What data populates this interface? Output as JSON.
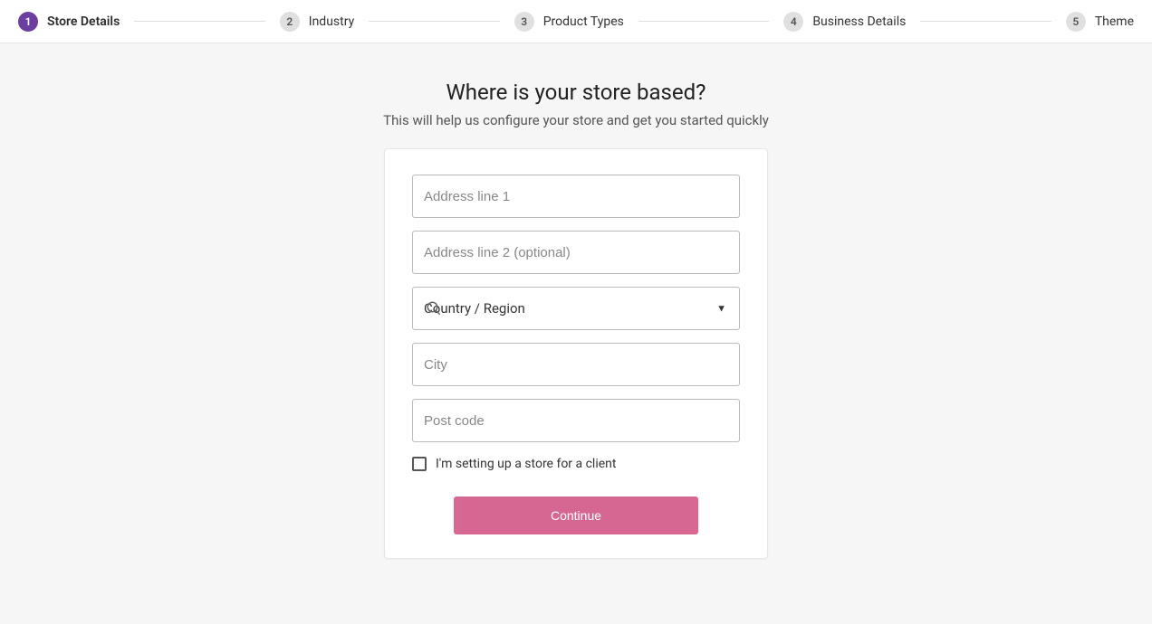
{
  "stepper": {
    "steps": [
      {
        "num": "1",
        "label": "Store Details",
        "active": true
      },
      {
        "num": "2",
        "label": "Industry",
        "active": false
      },
      {
        "num": "3",
        "label": "Product Types",
        "active": false
      },
      {
        "num": "4",
        "label": "Business Details",
        "active": false
      },
      {
        "num": "5",
        "label": "Theme",
        "active": false
      }
    ]
  },
  "heading": {
    "title": "Where is your store based?",
    "subtitle": "This will help us configure your store and get you started quickly"
  },
  "form": {
    "address1_placeholder": "Address line 1",
    "address2_placeholder": "Address line 2 (optional)",
    "country_placeholder": "Country / Region",
    "city_placeholder": "City",
    "postcode_placeholder": "Post code",
    "client_checkbox_label": "I'm setting up a store for a client",
    "continue_label": "Continue"
  }
}
